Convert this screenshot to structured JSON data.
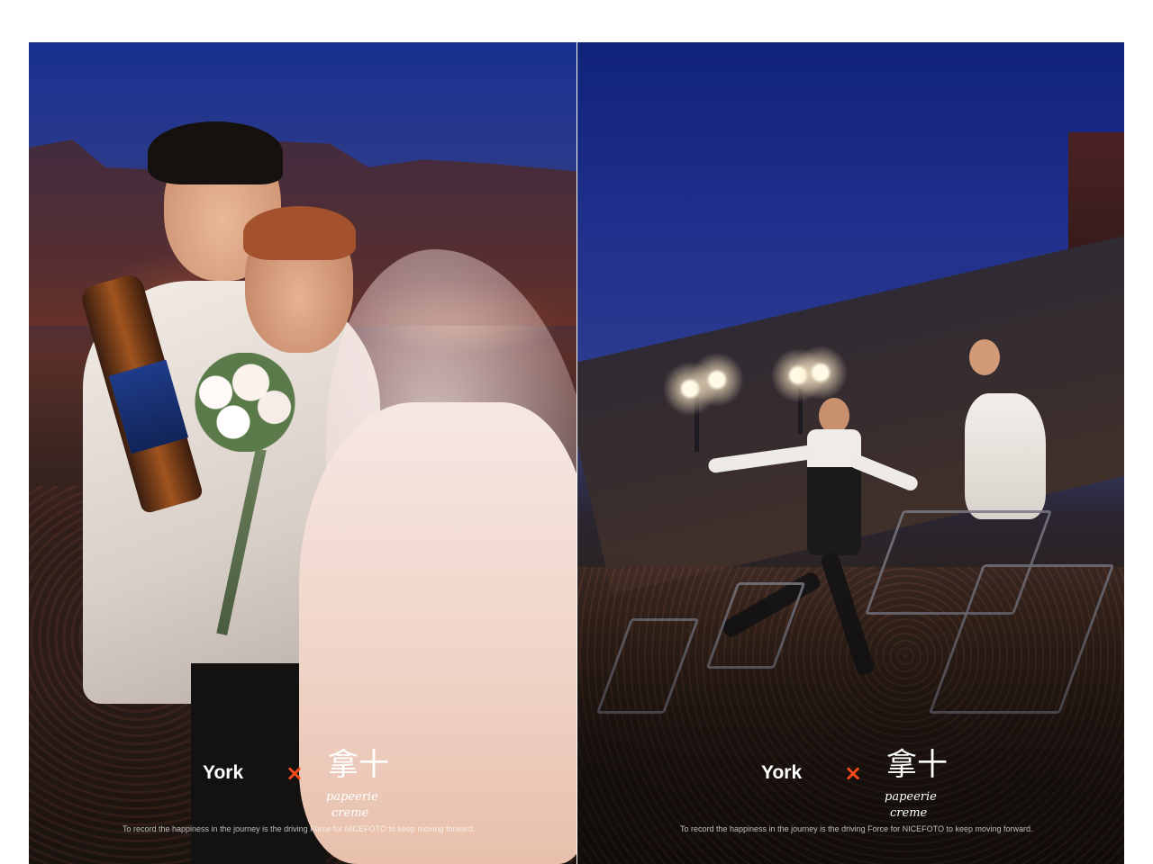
{
  "photos": [
    {
      "brand": {
        "location": "York",
        "separator": "×",
        "logo_glyph": "拿十",
        "logo_script": "papeerie creme"
      },
      "tagline": "To record the happiness in the journey is the driving  Force for NICEFOTO to keep moving forward."
    },
    {
      "brand": {
        "location": "York",
        "separator": "×",
        "logo_glyph": "拿十",
        "logo_script": "papeerie creme"
      },
      "tagline": "To record the happiness in the journey is the driving  Force for NICEFOTO to keep moving forward."
    }
  ],
  "colors": {
    "accent": "#ff4a1c",
    "text": "#ffffff",
    "background": "#ffffff"
  }
}
